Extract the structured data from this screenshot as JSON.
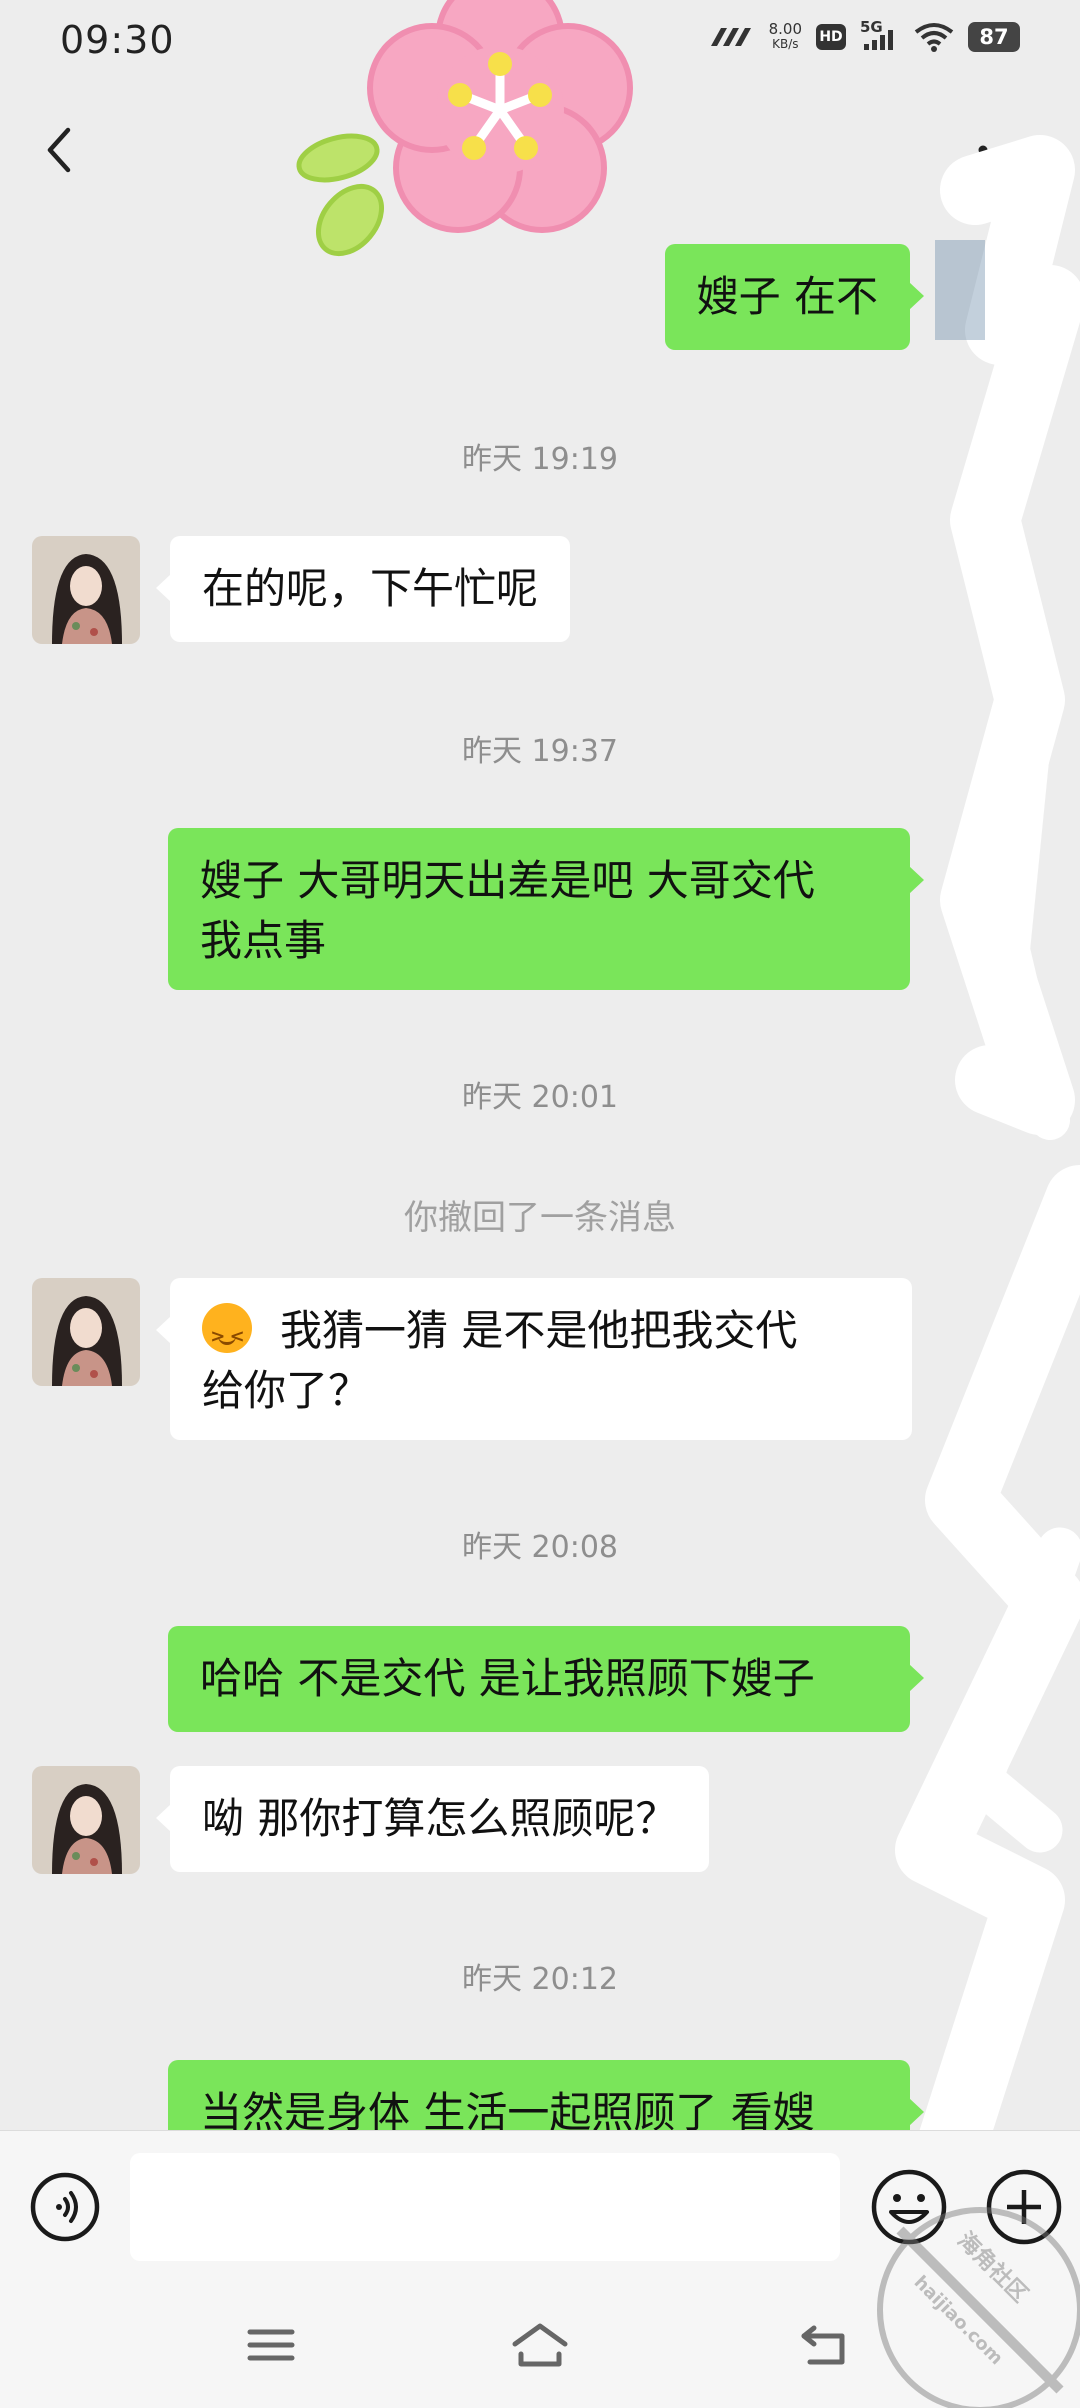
{
  "status_bar": {
    "time": "09:30",
    "net_speed_value": "8.00",
    "net_speed_unit": "KB/s",
    "hd_label": "HD",
    "network_label": "5G",
    "battery": "87"
  },
  "messages": {
    "m1": "嫂子  在不",
    "t1": "昨天 19:19",
    "m2": "在的呢，下午忙呢",
    "t2": "昨天 19:37",
    "m3_line1": "嫂子  大哥明天出差是吧  大哥交代",
    "m3_line2": "我点事",
    "t3": "昨天 20:01",
    "recall": "你撤回了一条消息",
    "m4_line1": "我猜一猜  是不是他把我交代",
    "m4_line2": "给你了？",
    "t4": "昨天 20:08",
    "m5": "哈哈  不是交代  是让我照顾下嫂子",
    "m6": "呦  那你打算怎么照顾呢？",
    "t5": "昨天 20:12",
    "m7": "当然是身体  生活一起照顾了  看嫂"
  },
  "input": {
    "value": ""
  },
  "watermark": {
    "line1": "海角社区",
    "line2": "haijiao.com"
  },
  "colors": {
    "outgoing_bubble": "#7ae55a",
    "incoming_bubble": "#ffffff",
    "background": "#ededed"
  },
  "icons": {
    "back": "chevron-left-icon",
    "more": "more-dots-icon",
    "voice": "voice-icon",
    "emoji": "emoji-icon",
    "plus": "plus-icon",
    "menu": "menu-icon",
    "home": "home-icon",
    "back_nav": "back-nav-icon"
  }
}
